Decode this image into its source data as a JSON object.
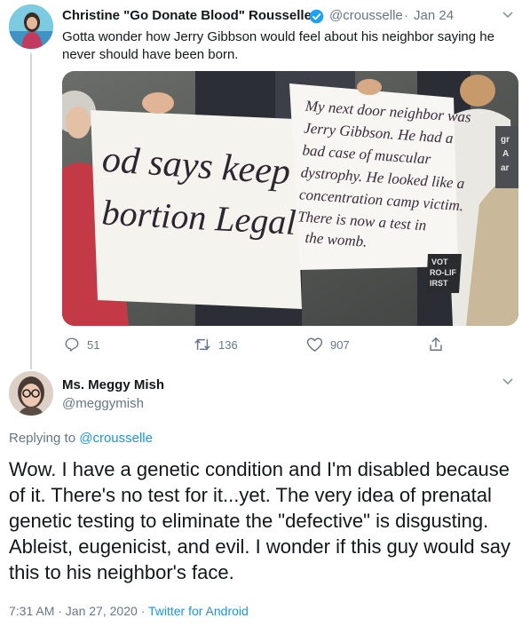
{
  "tweet1": {
    "display_name": "Christine \"Go Donate Blood\" Rousselle",
    "handle": "@crousselle",
    "separator": "·",
    "date": "Jan 24",
    "text_line1": "Gotta wonder how Jerry Gibbson would feel about his neighbor saying he",
    "text_line2": "never should have been born.",
    "sign_left_line1": "od says keep",
    "sign_left_line2": "bortion Legal",
    "sign_right_lines": [
      "My next door neighbor was",
      "Jerry Gibbson. He had a",
      "bad case of muscular",
      "dystrophy. He looked like a",
      "concentration camp victim.",
      "There is now a test in",
      "the womb."
    ],
    "bg_sign_lines": [
      "VOT",
      "RO-LIF",
      "IRST"
    ],
    "edge_sign_lines": [
      "gr",
      "A",
      "ar"
    ],
    "actions": {
      "replies": "51",
      "retweets": "136",
      "likes": "907"
    }
  },
  "reply": {
    "display_name": "Ms. Meggy Mish",
    "handle": "@meggymish",
    "replying_prefix": "Replying to",
    "replying_to": "@crousselle",
    "text": "Wow. I have a genetic condition and I'm disabled because of it. There's no test for it...yet. The very idea of prenatal genetic testing to eliminate the \"defective\" is disgusting. Ableist, eugenicist, and evil. I wonder if this guy would say this to his neighbor's face.",
    "timestamp": "7:31 AM · Jan 27, 2020",
    "separator": "·",
    "source": "Twitter for Android"
  },
  "icons": {
    "verified": "verified-badge-icon",
    "chevron": "chevron-down-icon",
    "reply": "reply-icon",
    "retweet": "retweet-icon",
    "like": "heart-icon",
    "share": "share-icon"
  },
  "colors": {
    "link": "#1b95e0",
    "verified": "#1da1f2",
    "muted": "#657786",
    "text": "#14171a"
  }
}
